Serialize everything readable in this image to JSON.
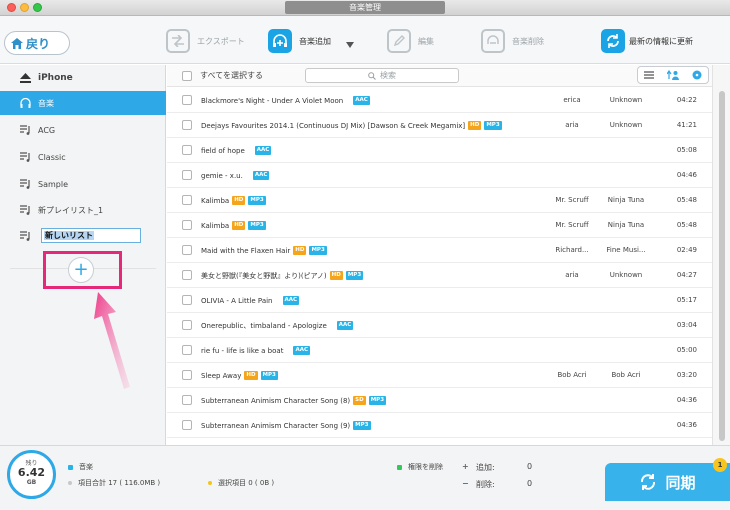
{
  "window": {
    "title": "音楽管理"
  },
  "toolbar": {
    "back_label": "戻り",
    "export_label": "エクスポート",
    "add_label": "音楽追加",
    "edit_label": "編集",
    "delete_label": "音楽削除",
    "refresh_label": "最新の情報に更新"
  },
  "sidebar": {
    "device": "iPhone",
    "items": [
      {
        "label": "音楽",
        "active": true
      },
      {
        "label": "ACG"
      },
      {
        "label": "Classic"
      },
      {
        "label": "Sample"
      },
      {
        "label": "新プレイリスト_1"
      }
    ],
    "new_playlist_value": "新しいリスト",
    "add_button_symbol": "+"
  },
  "list": {
    "select_all_label": "すべてを選択する",
    "search_placeholder": "検索",
    "rows": [
      {
        "title": "Blackmore's Night - Under A Violet Moon",
        "badges": [
          "AAC"
        ],
        "artist": "erica",
        "album": "Unknown",
        "duration": "04:22"
      },
      {
        "title": "Deejays Favourites 2014.1 (Continuous DJ Mix) [Dawson & Creek Megamix]",
        "badges": [
          "HD",
          "MP3"
        ],
        "artist": "aria",
        "album": "Unknown",
        "duration": "41:21"
      },
      {
        "title": "field of hope",
        "badges": [
          "AAC"
        ],
        "artist": "",
        "album": "",
        "duration": "05:08"
      },
      {
        "title": "gemie - x.u.",
        "badges": [
          "AAC"
        ],
        "artist": "",
        "album": "",
        "duration": "04:46"
      },
      {
        "title": "Kalimba",
        "badges": [
          "HD",
          "MP3"
        ],
        "artist": "Mr. Scruff",
        "album": "Ninja Tuna",
        "duration": "05:48"
      },
      {
        "title": "Kalimba",
        "badges": [
          "HD",
          "MP3"
        ],
        "artist": "Mr. Scruff",
        "album": "Ninja Tuna",
        "duration": "05:48"
      },
      {
        "title": "Maid with the Flaxen Hair",
        "badges": [
          "HD",
          "MP3"
        ],
        "artist": "Richard...",
        "album": "Fine Musi...",
        "duration": "02:49"
      },
      {
        "title": "美女と野獣(『美女と野獣』より)(ピアノ)",
        "badges": [
          "HD",
          "MP3"
        ],
        "artist": "aria",
        "album": "Unknown",
        "duration": "04:27"
      },
      {
        "title": "OLIVIA - A Little Pain",
        "badges": [
          "AAC"
        ],
        "artist": "",
        "album": "",
        "duration": "05:17"
      },
      {
        "title": "Onerepublic、timbaland - Apologize",
        "badges": [
          "AAC"
        ],
        "artist": "",
        "album": "",
        "duration": "03:04"
      },
      {
        "title": "rie fu - life is like a boat",
        "badges": [
          "AAC"
        ],
        "artist": "",
        "album": "",
        "duration": "05:00"
      },
      {
        "title": "Sleep Away",
        "badges": [
          "HD",
          "MP3"
        ],
        "artist": "Bob Acri",
        "album": "Bob Acri",
        "duration": "03:20"
      },
      {
        "title": "Subterranean Animism Character Song (8)",
        "badges": [
          "SD",
          "MP3"
        ],
        "artist": "",
        "album": "",
        "duration": "04:36"
      },
      {
        "title": "Subterranean Animism Character Song (9)",
        "badges": [
          "MP3"
        ],
        "artist": "",
        "album": "",
        "duration": "04:36"
      }
    ]
  },
  "status": {
    "remaining_label": "残り",
    "remaining_value": "6.42",
    "remaining_unit": "GB",
    "legend_music": "音楽",
    "total_items": "項目合計 17 ( 116.0MB )",
    "selected_items": "選択項目 0 ( 0B )",
    "legend_delete_rights": "権限を削除",
    "added_label": "追加:",
    "added_value": "0",
    "deleted_label": "削除:",
    "deleted_value": "0",
    "sync_label": "同期",
    "notification_count": "1"
  },
  "colors": {
    "accent": "#2ea8e6",
    "highlight_box": "#e6287b",
    "badge_blue": "#2ab3e6",
    "badge_orange": "#f5a51c",
    "legend_music": "#2ab3e6",
    "legend_total": "#c8c8c8",
    "legend_selected": "#f5c518",
    "legend_delete": "#34c759"
  }
}
